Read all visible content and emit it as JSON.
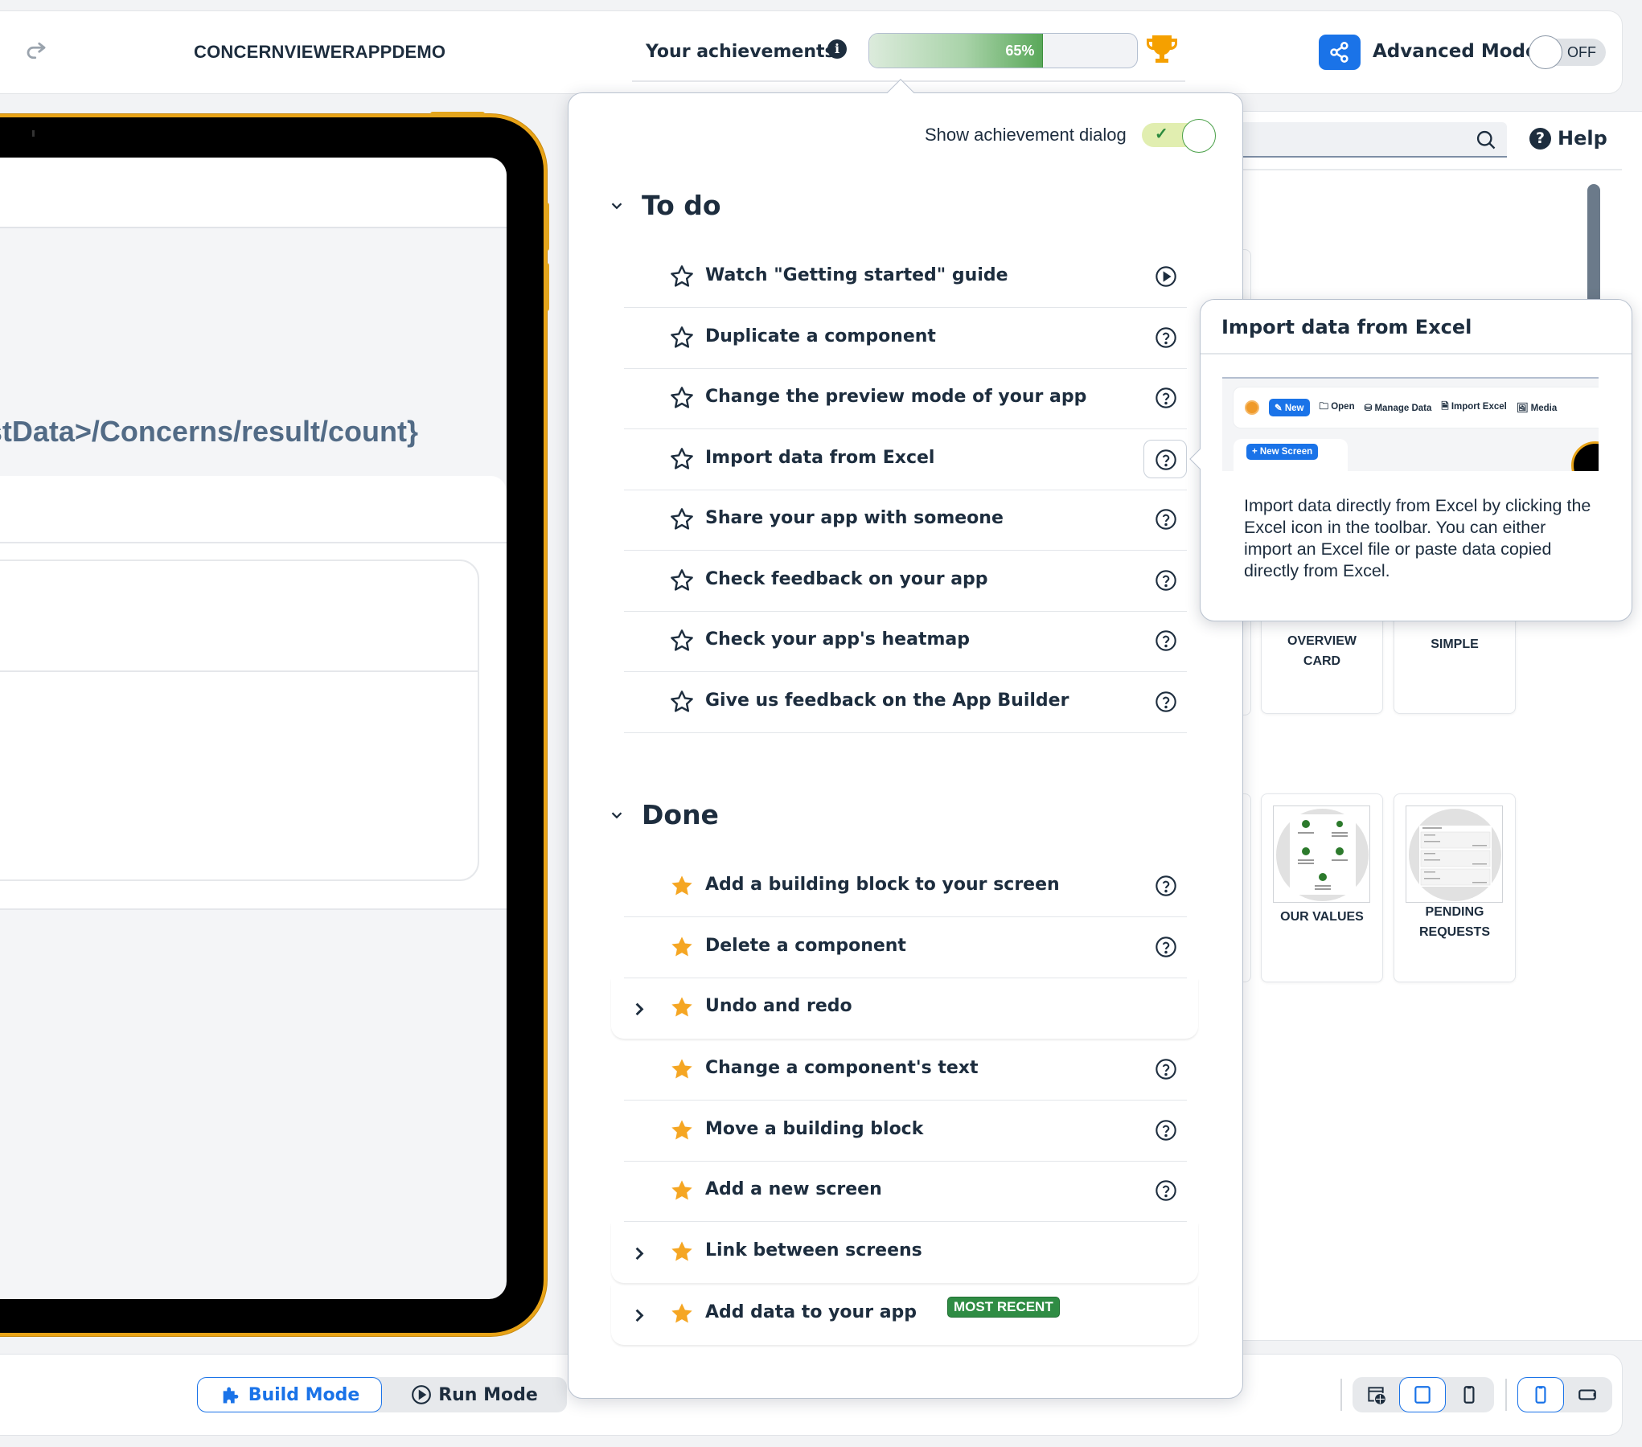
{
  "header": {
    "app_title": "CONCERNVIEWERAPPDEMO",
    "achievements_label": "Your achievements",
    "progress_percent": 65,
    "progress_label": "65%",
    "advanced_mode_label": "Advanced Mode",
    "advanced_mode_state": "OFF"
  },
  "preview": {
    "binding_text": "stData>/Concerns/result/count}"
  },
  "right_panel": {
    "search_placeholder": "",
    "help_label": "Help",
    "building_blocks": [
      {
        "label_line1": "OVERVIEW",
        "label_line2": "CARD"
      },
      {
        "label_line1": "SIMPLE",
        "label_line2": ""
      },
      {
        "label_line1": "OUR VALUES",
        "label_line2": ""
      },
      {
        "label_line1": "PENDING",
        "label_line2": "REQUESTS"
      }
    ]
  },
  "achievements": {
    "show_dialog_label": "Show achievement dialog",
    "show_dialog_enabled": true,
    "todo": {
      "title": "To do",
      "items": [
        {
          "label": "Watch \"Getting started\" guide",
          "action_icon": "play-circle-icon"
        },
        {
          "label": "Duplicate a component",
          "action_icon": "question-circle-icon"
        },
        {
          "label": "Change the preview mode of your app",
          "action_icon": "question-circle-icon"
        },
        {
          "label": "Import data from Excel",
          "action_icon": "question-circle-icon",
          "active": true
        },
        {
          "label": "Share your app with someone",
          "action_icon": "question-circle-icon"
        },
        {
          "label": "Check feedback on your app",
          "action_icon": "question-circle-icon"
        },
        {
          "label": "Check your app's heatmap",
          "action_icon": "question-circle-icon"
        },
        {
          "label": "Give us feedback on the App Builder",
          "action_icon": "question-circle-icon"
        }
      ]
    },
    "done": {
      "title": "Done",
      "items": [
        {
          "label": "Add a building block to your screen",
          "expandable": false
        },
        {
          "label": "Delete a component",
          "expandable": false
        },
        {
          "label": "Undo and redo",
          "expandable": true
        },
        {
          "label": "Change a component's text",
          "expandable": false
        },
        {
          "label": "Move a building block",
          "expandable": false
        },
        {
          "label": "Add a new screen",
          "expandable": false
        },
        {
          "label": "Link between screens",
          "expandable": true
        },
        {
          "label": "Add data to your app",
          "expandable": true,
          "badge": "MOST RECENT"
        }
      ]
    }
  },
  "tooltip": {
    "title": "Import data from Excel",
    "preview_toolbar": {
      "new": "New",
      "open": "Open",
      "manage_data": "Manage Data",
      "import_excel": "Import Excel",
      "media": "Media",
      "new_screen": "+ New Screen"
    },
    "body": "Import data directly from Excel by clicking the Excel icon in the toolbar. You can either import an Excel file or paste data copied directly from Excel."
  },
  "bottom_bar": {
    "build_mode_label": "Build Mode",
    "run_mode_label": "Run Mode",
    "active_mode": "Build Mode",
    "device_buttons": [
      "web-preview",
      "tablet",
      "phone"
    ],
    "active_device": "tablet",
    "orientation_buttons": [
      "portrait",
      "landscape"
    ],
    "active_orientation": "portrait"
  },
  "colors": {
    "primary_blue": "#1a73e8",
    "text_dark": "#1d2d3e",
    "star_gold": "#f5a623",
    "trophy_orange": "#f5a000",
    "badge_green": "#2f8c44",
    "device_frame": "#e8a317"
  }
}
